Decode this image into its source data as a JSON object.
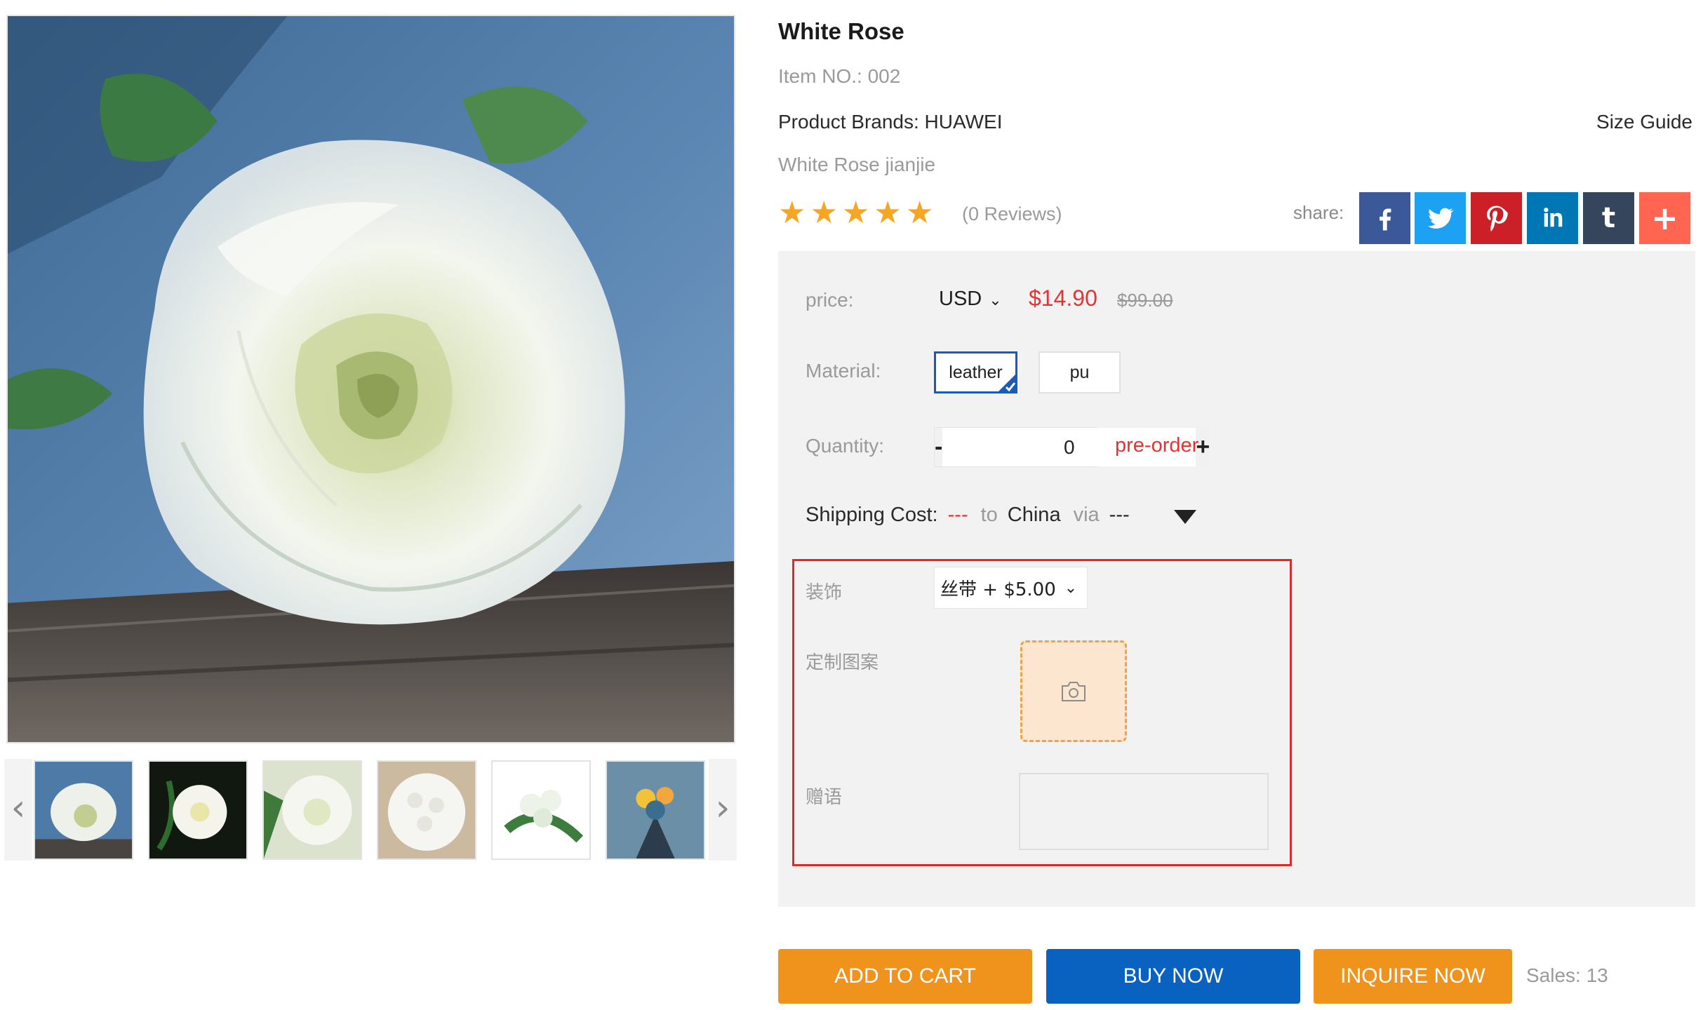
{
  "product": {
    "title": "White Rose",
    "item_no": "Item NO.: 002",
    "brand": "Product Brands: HUAWEI",
    "subtitle": "White Rose jianjie",
    "size_guide": "Size Guide",
    "rating_stars": 5,
    "reviews": "(0 Reviews)"
  },
  "share": {
    "label": "share:",
    "networks": [
      "facebook",
      "twitter",
      "pinterest",
      "linkedin",
      "tumblr",
      "more"
    ],
    "colors": {
      "facebook": "#3b5998",
      "twitter": "#1da1f2",
      "pinterest": "#cb2027",
      "linkedin": "#0077b5",
      "tumblr": "#35465c",
      "more": "#ff6550"
    },
    "glyphs": {
      "tumblr": "t",
      "more": "+"
    }
  },
  "gallery": {
    "thumbnails": [
      "white-rose-closeup",
      "white-rose-dark",
      "white-rose-bloom",
      "white-roses-bouquet",
      "white-flowers-arrangement",
      "mixed-bouquet"
    ],
    "prev_glyph": "‹",
    "next_glyph": "›"
  },
  "options": {
    "price_label": "price:",
    "currency": "USD",
    "currency_chevron": "⌄",
    "price": "$14.90",
    "original_price": "$99.00",
    "material_label": "Material:",
    "materials": [
      "leather",
      "pu"
    ],
    "selected_material": "leather",
    "quantity_label": "Quantity:",
    "qty_minus": "-",
    "qty_plus": "+",
    "quantity": "0",
    "pre_order": "pre-order",
    "shipping_label": "Shipping Cost:",
    "shipping_cost": "---",
    "shipping_to": "to",
    "shipping_country": "China",
    "shipping_via": "via",
    "shipping_method": "---"
  },
  "customization": {
    "decoration_label": "装饰",
    "decoration_value": "丝带 + $5.00",
    "decoration_chevron": "⌄",
    "pattern_label": "定制图案",
    "message_label": "赠语",
    "message_value": ""
  },
  "actions": {
    "add_to_cart": "ADD TO CART",
    "buy_now": "BUY NOW",
    "inquire_now": "INQUIRE NOW",
    "sales": "Sales: 13"
  },
  "colors": {
    "accent_orange": "#f0931d",
    "accent_blue": "#0a62c0",
    "price_red": "#e23434",
    "star": "#f5a623",
    "highlight_border": "#e02a2a"
  }
}
